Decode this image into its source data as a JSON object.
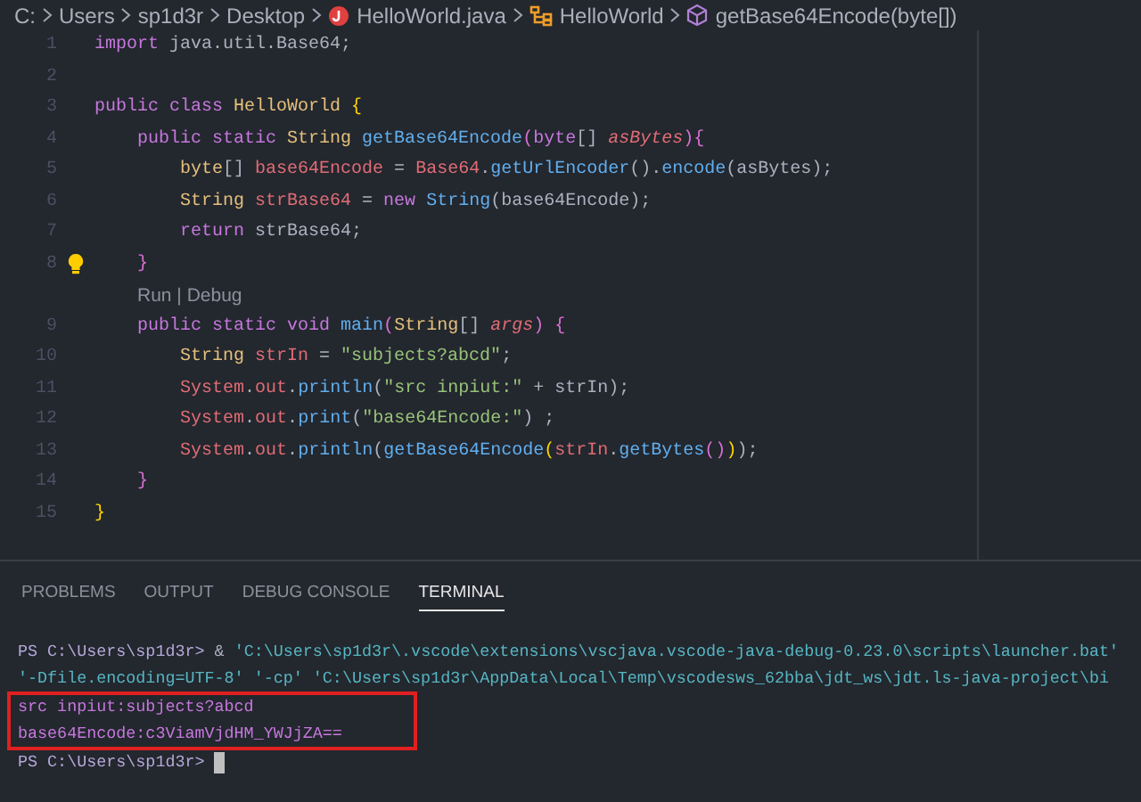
{
  "breadcrumb": [
    {
      "label": "C:",
      "kind": "folder"
    },
    {
      "label": "Users",
      "kind": "folder"
    },
    {
      "label": "sp1d3r",
      "kind": "folder"
    },
    {
      "label": "Desktop",
      "kind": "folder"
    },
    {
      "label": "HelloWorld.java",
      "kind": "file"
    },
    {
      "label": "HelloWorld",
      "kind": "class"
    },
    {
      "label": "getBase64Encode(byte[])",
      "kind": "method"
    }
  ],
  "editor": {
    "lines": [
      {
        "kind": "code",
        "number": "1",
        "tokens": [
          {
            "text": "import",
            "kind": "keyword"
          },
          {
            "text": " java.util.Base64;",
            "kind": "plain"
          }
        ]
      },
      {
        "kind": "code",
        "number": "2"
      },
      {
        "kind": "code",
        "number": "3",
        "tokens": [
          {
            "text": "public class",
            "kind": "keyword"
          },
          {
            "text": " HelloWorld",
            "kind": "type"
          },
          {
            "text": " {",
            "kind": "bracket1"
          }
        ]
      },
      {
        "kind": "code",
        "number": "4",
        "tokens": [
          {
            "text": "    public static",
            "kind": "keyword"
          },
          {
            "text": " String",
            "kind": "type"
          },
          {
            "text": " getBase64Encode",
            "kind": "function"
          },
          {
            "text": "(",
            "kind": "bracket2"
          },
          {
            "text": "byte",
            "kind": "keyword"
          },
          {
            "text": "[] ",
            "kind": "plain"
          },
          {
            "text": "asBytes",
            "kind": "parameter"
          },
          {
            "text": "){",
            "kind": "bracket2"
          }
        ]
      },
      {
        "kind": "code",
        "number": "5",
        "tokens": [
          {
            "text": "        byte",
            "kind": "type"
          },
          {
            "text": "[] ",
            "kind": "plain"
          },
          {
            "text": "base64Encode",
            "kind": "variable"
          },
          {
            "text": " = ",
            "kind": "plain"
          },
          {
            "text": "Base64",
            "kind": "variable"
          },
          {
            "text": ".",
            "kind": "plain"
          },
          {
            "text": "getUrlEncoder",
            "kind": "function"
          },
          {
            "text": "().",
            "kind": "plain"
          },
          {
            "text": "encode",
            "kind": "function"
          },
          {
            "text": "(asBytes);",
            "kind": "plain"
          }
        ]
      },
      {
        "kind": "code",
        "number": "6",
        "tokens": [
          {
            "text": "        String",
            "kind": "type"
          },
          {
            "text": " strBase64",
            "kind": "variable"
          },
          {
            "text": " = ",
            "kind": "plain"
          },
          {
            "text": "new",
            "kind": "keyword"
          },
          {
            "text": " String",
            "kind": "function"
          },
          {
            "text": "(base64Encode);",
            "kind": "plain"
          }
        ]
      },
      {
        "kind": "code",
        "number": "7",
        "tokens": [
          {
            "text": "        return",
            "kind": "keyword"
          },
          {
            "text": " strBase64;",
            "kind": "plain"
          }
        ]
      },
      {
        "kind": "bulb",
        "number": "8",
        "tokens": [
          {
            "text": "    }",
            "kind": "bracket2"
          }
        ]
      },
      {
        "kind": "lens",
        "text": "Run | Debug"
      },
      {
        "kind": "code",
        "number": "9",
        "tokens": [
          {
            "text": "    public static void",
            "kind": "keyword"
          },
          {
            "text": " main",
            "kind": "function"
          },
          {
            "text": "(",
            "kind": "bracket2"
          },
          {
            "text": "String",
            "kind": "type"
          },
          {
            "text": "[] ",
            "kind": "plain"
          },
          {
            "text": "args",
            "kind": "parameter"
          },
          {
            "text": ") {",
            "kind": "bracket2"
          }
        ]
      },
      {
        "kind": "code",
        "number": "10",
        "tokens": [
          {
            "text": "        String",
            "kind": "type"
          },
          {
            "text": " strIn",
            "kind": "variable"
          },
          {
            "text": " = ",
            "kind": "plain"
          },
          {
            "text": "\"subjects?abcd\"",
            "kind": "string"
          },
          {
            "text": ";",
            "kind": "plain"
          }
        ]
      },
      {
        "kind": "code",
        "number": "11",
        "tokens": [
          {
            "text": "        System",
            "kind": "variable"
          },
          {
            "text": ".",
            "kind": "plain"
          },
          {
            "text": "out",
            "kind": "variable"
          },
          {
            "text": ".",
            "kind": "plain"
          },
          {
            "text": "println",
            "kind": "function"
          },
          {
            "text": "(",
            "kind": "plain"
          },
          {
            "text": "\"src inpiut:\"",
            "kind": "string"
          },
          {
            "text": " + strIn);",
            "kind": "plain"
          }
        ]
      },
      {
        "kind": "code",
        "number": "12",
        "tokens": [
          {
            "text": "        System",
            "kind": "variable"
          },
          {
            "text": ".",
            "kind": "plain"
          },
          {
            "text": "out",
            "kind": "variable"
          },
          {
            "text": ".",
            "kind": "plain"
          },
          {
            "text": "print",
            "kind": "function"
          },
          {
            "text": "(",
            "kind": "plain"
          },
          {
            "text": "\"base64Encode:\"",
            "kind": "string"
          },
          {
            "text": ") ;",
            "kind": "plain"
          }
        ]
      },
      {
        "kind": "code",
        "number": "13",
        "tokens": [
          {
            "text": "        System",
            "kind": "variable"
          },
          {
            "text": ".",
            "kind": "plain"
          },
          {
            "text": "out",
            "kind": "variable"
          },
          {
            "text": ".",
            "kind": "plain"
          },
          {
            "text": "println",
            "kind": "function"
          },
          {
            "text": "(",
            "kind": "plain"
          },
          {
            "text": "getBase64Encode",
            "kind": "function"
          },
          {
            "text": "(",
            "kind": "bracket1"
          },
          {
            "text": "strIn",
            "kind": "variable"
          },
          {
            "text": ".",
            "kind": "plain"
          },
          {
            "text": "getBytes",
            "kind": "function"
          },
          {
            "text": "()",
            "kind": "bracket2"
          },
          {
            "text": ")",
            "kind": "bracket1"
          },
          {
            "text": ");",
            "kind": "plain"
          }
        ]
      },
      {
        "kind": "code",
        "number": "14",
        "tokens": [
          {
            "text": "    }",
            "kind": "bracket2"
          }
        ]
      },
      {
        "kind": "code",
        "number": "15",
        "tokens": [
          {
            "text": "}",
            "kind": "bracket1"
          }
        ]
      }
    ]
  },
  "panel": {
    "tabs": [
      {
        "label": "PROBLEMS",
        "selected": false
      },
      {
        "label": "OUTPUT",
        "selected": false
      },
      {
        "label": "DEBUG CONSOLE",
        "selected": false
      },
      {
        "label": "TERMINAL",
        "selected": true
      }
    ],
    "terminal": [
      {
        "kind": "command",
        "highlighted": false,
        "tokens": [
          {
            "text": "PS C:\\Users\\sp1d3r>",
            "kind": "prompt"
          },
          {
            "text": " & ",
            "kind": "plain"
          },
          {
            "text": "'C:\\Users\\sp1d3r\\.vscode\\extensions\\vscjava.vscode-java-debug-0.23.0\\scripts\\launcher.bat'",
            "kind": "path"
          }
        ]
      },
      {
        "kind": "command",
        "highlighted": false,
        "tokens": [
          {
            "text": "'-Dfile.encoding=UTF-8' '-cp' 'C:\\Users\\sp1d3r\\AppData\\Local\\Temp\\vscodesws_62bba\\jdt_ws\\jdt.ls-java-project\\bi",
            "kind": "path"
          }
        ]
      },
      {
        "kind": "output",
        "highlighted": true,
        "tokens": [
          {
            "text": "src inpiut:subjects?abcd",
            "kind": "output"
          }
        ]
      },
      {
        "kind": "output",
        "highlighted": true,
        "tokens": [
          {
            "text": "base64Encode:c3ViamVjdHM_YWJjZA==",
            "kind": "output"
          }
        ]
      },
      {
        "kind": "prompt",
        "highlighted": false,
        "tokens": [
          {
            "text": "PS C:\\Users\\sp1d3r>",
            "kind": "prompt"
          }
        ]
      }
    ]
  }
}
